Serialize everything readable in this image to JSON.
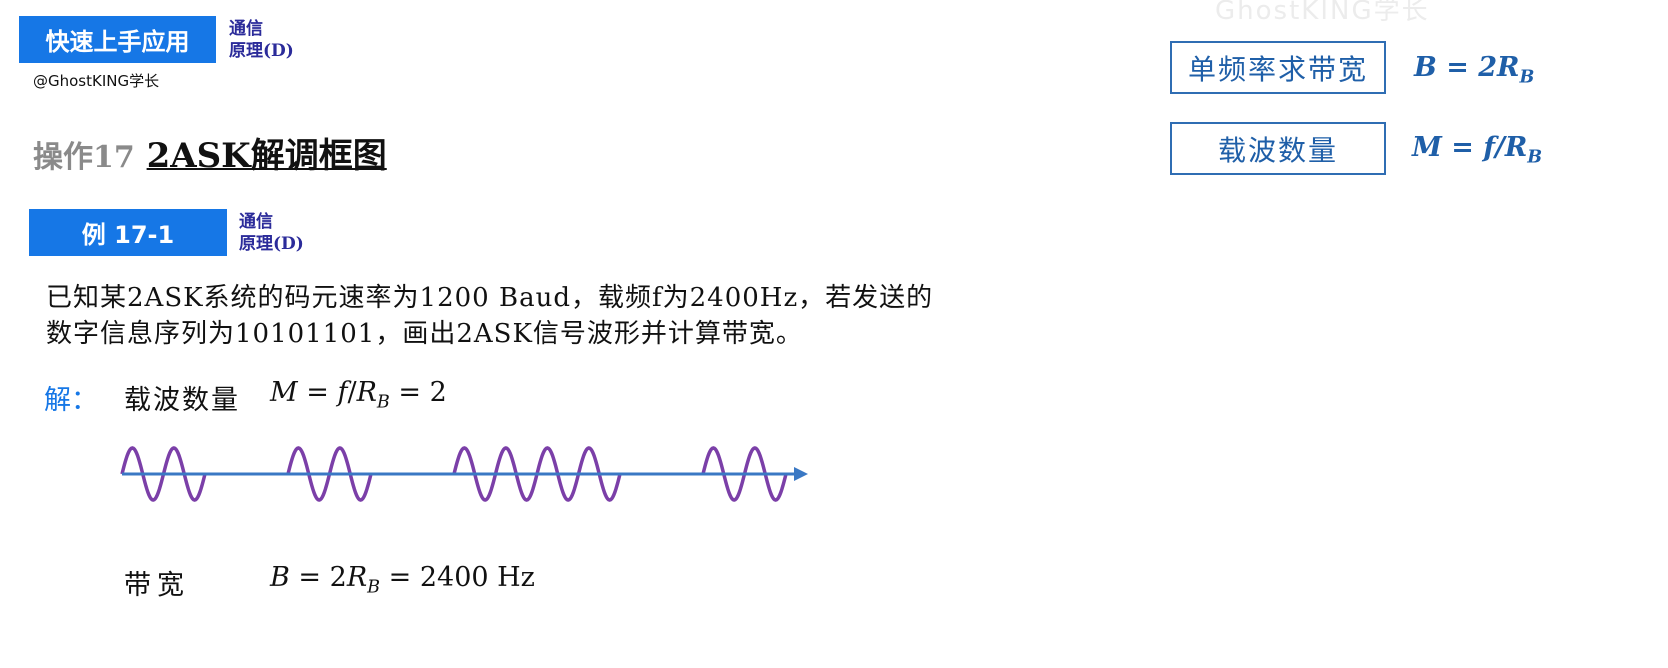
{
  "header": {
    "badge": "快速上手应用",
    "tag_line1": "通信",
    "tag_line2": "原理(D)",
    "author": "@GhostKING学长",
    "watermark": "GhostKING学长"
  },
  "title": {
    "prefix": "操作17",
    "main": "2ASK解调框图"
  },
  "example": {
    "badge": "例 17-1",
    "tag_line1": "通信",
    "tag_line2": "原理(D)",
    "problem_line1": "已知某2ASK系统的码元速率为1200 Baud，载频f为2400Hz，若发送的",
    "problem_line2": "数字信息序列为10101101，画出2ASK信号波形并计算带宽。"
  },
  "solution": {
    "label": "解：",
    "carrier_label": "载波数量",
    "carrier_formula": "M = f/R_B = 2",
    "bandwidth_label": "带宽",
    "bandwidth_formula": "B = 2R_B = 2400 Hz"
  },
  "summary_boxes": [
    {
      "label": "单频率求带宽",
      "formula": "B = 2R_B"
    },
    {
      "label": "载波数量",
      "formula": "M = f/R_B"
    }
  ],
  "waveform": {
    "bits": [
      1,
      0,
      1,
      0,
      1,
      1,
      0,
      1
    ],
    "cycles_per_bit": 2,
    "wave_color": "#7b3fa8",
    "axis_color": "#3a78c4"
  },
  "colors": {
    "accent": "#1677e6",
    "formula_blue": "#1f5fa8",
    "tag_purple": "#2b2b9a"
  }
}
